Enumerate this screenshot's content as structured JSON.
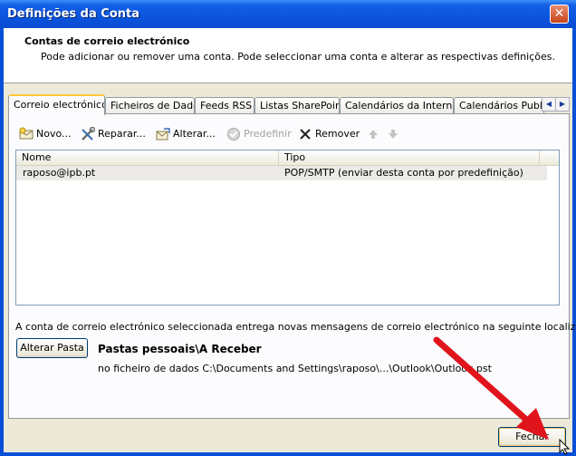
{
  "window": {
    "title": "Definições da Conta",
    "close_symbol": "✕"
  },
  "header": {
    "title": "Contas de correio electrónico",
    "description": "Pode adicionar ou remover uma conta. Pode seleccionar uma conta e alterar as respectivas definições."
  },
  "tabs": [
    {
      "label": "Correio electrónico",
      "active": true
    },
    {
      "label": "Ficheiros de Dados"
    },
    {
      "label": "Feeds RSS"
    },
    {
      "label": "Listas SharePoint"
    },
    {
      "label": "Calendários da Internet"
    },
    {
      "label": "Calendários Publica"
    }
  ],
  "toolbar": {
    "new": "Novo...",
    "repair": "Reparar...",
    "change": "Alterar...",
    "set_default": "Predefinir",
    "remove": "Remover"
  },
  "list": {
    "columns": [
      "Nome",
      "Tipo"
    ],
    "rows": [
      {
        "name": "raposo@ipb.pt",
        "type": "POP/SMTP (enviar desta conta por predefinição)"
      }
    ]
  },
  "delivery": {
    "info": "A conta de correio electrónico seleccionada entrega novas mensagens de correio electrónico na seguinte localização:",
    "change_folder_button": "Alterar Pasta",
    "folder": "Pastas pessoais\\A Receber",
    "data_file": "no ficheiro de dados C:\\Documents and Settings\\raposo\\...\\Outlook\\Outlook.pst"
  },
  "footer": {
    "close_button": "Fechar"
  },
  "colors": {
    "titlebar": "#0a4fd8",
    "arrow": "#e0141c",
    "tab_highlight": "#ffc83c"
  }
}
